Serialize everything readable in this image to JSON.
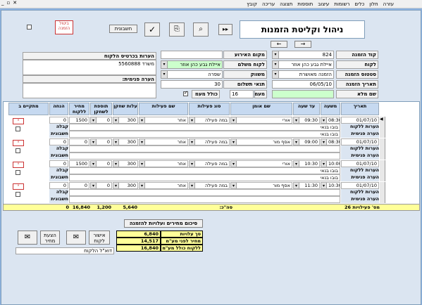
{
  "menu": [
    "עזרה",
    "חלון",
    "כלים",
    "רשומות",
    "עיצוב",
    "תוספות",
    "תצוגה",
    "עריכה",
    "קובץ"
  ],
  "title": "ניהול וקליטת הזמנות",
  "buttons": {
    "cancel_order": "ביטול\nהזמנה",
    "invoices": "חשבונית",
    "approve_customer": "אישור\nלקוח",
    "price_quote": "הצעת\nמחיר"
  },
  "fields": {
    "order_code_label": "קוד הזמנה",
    "order_code": "824",
    "customer_label": "לקוח",
    "customer": "איילת גבע כהן אוזר",
    "order_status_label": "סטטוס הזמנה",
    "order_status": "הזמנה מאושרת",
    "order_date_label": "תאריך הזמנה",
    "order_date": "06/05/10",
    "full_name_label": "שם מלא",
    "event_place_label": "מקום האירוע",
    "paying_customer_label": "לקוח משלם",
    "paying_customer": "איילת גבע כהן אוזר",
    "marketer_label": "משווק",
    "marketer": "שפרה",
    "payment_terms_label": "תנאי תשלום",
    "payment_terms": "30",
    "vat_label": "מעמ",
    "vat": "16",
    "incl_vat_label": "כולל מעמ",
    "customer_notes_label": "הערות בכרטיס הלקוח",
    "customer_notes": "משרד 5560888",
    "internal_note_label": "הערה פנימית:"
  },
  "grid": {
    "headers": [
      "תאריך",
      "משעה",
      "עד שעה",
      "שם אומן",
      "סוג פעילות",
      "שם פעילות",
      "עלות שחקן",
      "תוספת לשחקן",
      "מחיר ללקוח",
      "הנחה",
      "מתקיים ב"
    ],
    "sub_labels": {
      "notes": "הערות ללקוח",
      "internal": "הערה פנימית",
      "accept": "קבלה",
      "invoice": "חשבונית"
    },
    "rows": [
      {
        "date": "01/07/10",
        "from": "08:30",
        "to": "09:30",
        "artist": "אורי",
        "type": "במה פעילה",
        "activity": "אחר",
        "cost": "300",
        "extra": "0",
        "price": "1500",
        "disc": "0",
        "notes": "בובו בנאי",
        "internal": "בובו בנאי"
      },
      {
        "date": "01/07/10",
        "from": "08:30",
        "to": "09:00",
        "artist": "אסף מור",
        "type": "במה פעילה",
        "activity": "אחר",
        "cost": "300",
        "extra": "0",
        "price": "0",
        "disc": "0",
        "notes": "",
        "internal": ""
      },
      {
        "date": "01/07/10",
        "from": "10:00",
        "to": "10:30",
        "artist": "אורי",
        "type": "במה פעילה",
        "activity": "אחר",
        "cost": "300",
        "extra": "0",
        "price": "1500",
        "disc": "0",
        "notes": "בובו בנאי",
        "internal": "בובו בנאי"
      },
      {
        "date": "01/07/10",
        "from": "10:30",
        "to": "11:30",
        "artist": "אסף מור",
        "type": "במה פעילה",
        "activity": "אחר",
        "cost": "300",
        "extra": "0",
        "price": "0",
        "disc": "0",
        "notes": "",
        "internal": ""
      }
    ],
    "totals": {
      "count_label": "מס' פעילויות",
      "count": "26",
      "sum_label": "סה\"כ:",
      "cost": "5,640",
      "extra": "1,200",
      "price": "16,840",
      "disc": "0"
    }
  },
  "summary": {
    "button": "סיכום מחירים ועלויות להזמנה",
    "rows": [
      {
        "label": "סך עלויות",
        "value": "6,840"
      },
      {
        "label": "מחיר לפני מע\"מ",
        "value": "14,517"
      },
      {
        "label": "ללקוח כולל מע\"מ",
        "value": "16,840"
      }
    ],
    "customer_report": "דוא\"ל הלקוח"
  }
}
